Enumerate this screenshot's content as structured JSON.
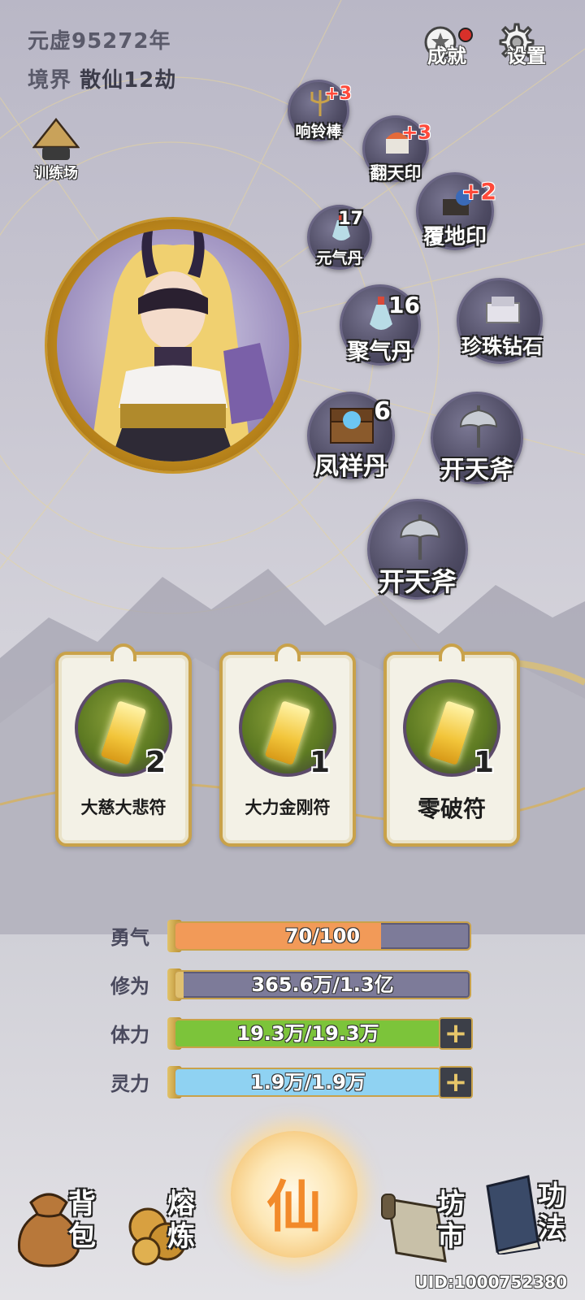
{
  "header": {
    "era": "元虚95272年",
    "realm_label": "境界",
    "realm_value": "散仙12劫"
  },
  "top_buttons": {
    "achievements": "成就",
    "settings": "设置"
  },
  "training": {
    "label": "训练场"
  },
  "items": [
    {
      "name": "响铃棒",
      "plus": "+3"
    },
    {
      "name": "翻天印",
      "plus": "+3"
    },
    {
      "name": "覆地印",
      "plus": "+2"
    },
    {
      "name": "元气丹",
      "count": "17"
    },
    {
      "name": "聚气丹",
      "count": "16"
    },
    {
      "name": "珍珠钻石"
    },
    {
      "name": "凤祥丹",
      "count": "6"
    },
    {
      "name": "开天斧"
    },
    {
      "name": "开天斧"
    }
  ],
  "talismans": [
    {
      "name": "大慈大悲符",
      "count": "2"
    },
    {
      "name": "大力金刚符",
      "count": "1"
    },
    {
      "name": "零破符",
      "count": "1"
    }
  ],
  "stats": [
    {
      "label": "勇气",
      "value": "70/100",
      "progress": 0.7,
      "color": "#f29a58"
    },
    {
      "label": "修为",
      "value": "365.6万/1.3亿",
      "progress": 0.028,
      "color": "#e0c070"
    },
    {
      "label": "体力",
      "value": "19.3万/19.3万",
      "progress": 1.0,
      "color": "#7cc43a"
    },
    {
      "label": "灵力",
      "value": "1.9万/1.9万",
      "progress": 1.0,
      "color": "#8fd2f2"
    }
  ],
  "nav": {
    "bag": "背包",
    "forge": "熔炼",
    "center": "仙",
    "market": "坊市",
    "skills": "功法"
  },
  "uid": "UID:1000752380"
}
